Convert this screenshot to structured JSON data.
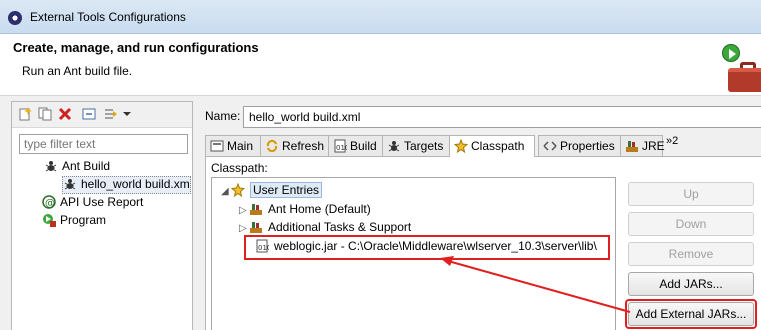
{
  "window": {
    "title": "External Tools Configurations"
  },
  "header": {
    "title": "Create, manage, and run configurations",
    "description": "Run an Ant build file."
  },
  "left": {
    "filter_placeholder": "type filter text",
    "tree": [
      {
        "label": "Ant Build",
        "icon": "ant-icon"
      },
      {
        "label": "hello_world build.xml",
        "icon": "ant-icon",
        "selected": true
      },
      {
        "label": "API Use Report",
        "icon": "api-report-icon"
      },
      {
        "label": "Program",
        "icon": "program-icon"
      }
    ]
  },
  "config": {
    "name_label": "Name:",
    "name_value": "hello_world build.xml"
  },
  "tabs": [
    {
      "label": "Main"
    },
    {
      "label": "Refresh"
    },
    {
      "label": "Build"
    },
    {
      "label": "Targets"
    },
    {
      "label": "Classpath",
      "active": true
    },
    {
      "label": "Properties"
    },
    {
      "label": "JRE"
    }
  ],
  "tabs_overflow": "»2",
  "classpath": {
    "label": "Classpath:",
    "entries": [
      {
        "label": "User Entries",
        "icon": "user-entries-icon"
      },
      {
        "label": "Ant Home (Default)",
        "icon": "library-icon"
      },
      {
        "label": "Additional Tasks & Support",
        "icon": "library-icon"
      },
      {
        "label": "weblogic.jar - C:\\Oracle\\Middleware\\wlserver_10.3\\server\\lib\\",
        "icon": "jar-icon"
      }
    ]
  },
  "buttons": {
    "up": "Up",
    "down": "Down",
    "remove": "Remove",
    "add_jars": "Add JARs...",
    "add_external_jars": "Add External JARs..."
  },
  "colors": {
    "annotation": "#e02020",
    "selection": "#dfeaf7"
  }
}
